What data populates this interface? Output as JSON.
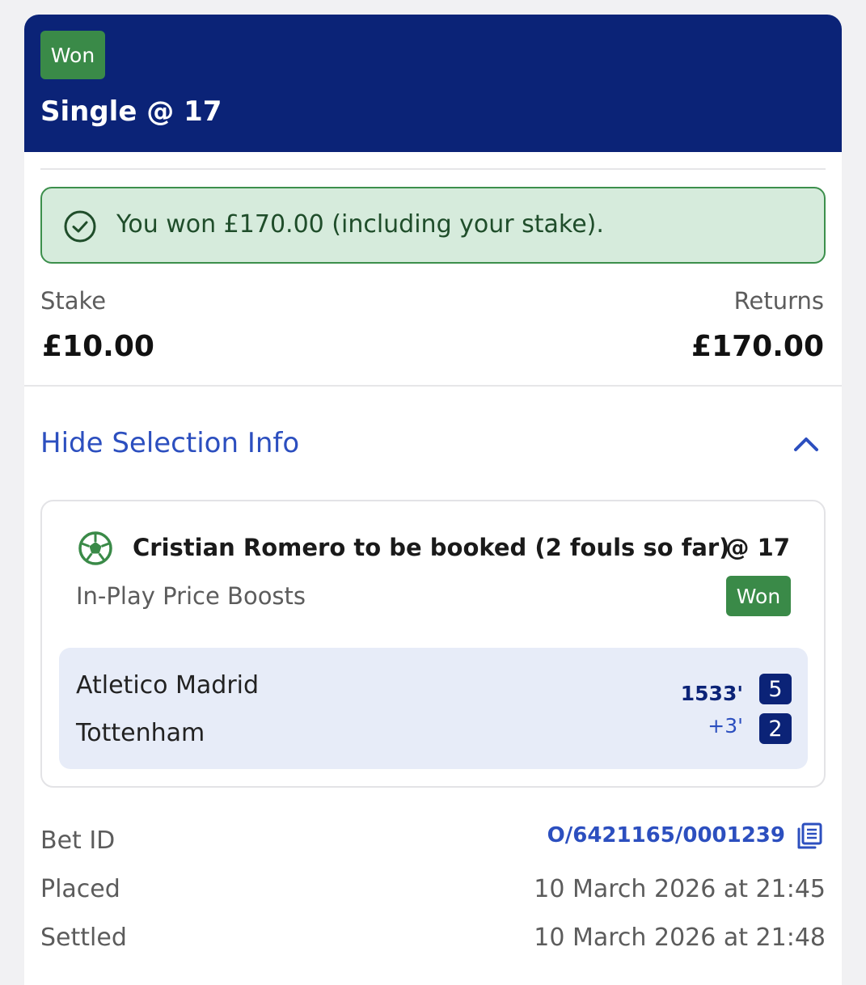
{
  "header": {
    "status_badge": "Won",
    "title": "Single @ 17",
    "background_color": "#0b2377"
  },
  "win_banner": {
    "icon": "check-circle-icon",
    "text": "You won £170.00 (including your stake)."
  },
  "summary": {
    "stake_label": "Stake",
    "stake_value": "£10.00",
    "returns_label": "Returns",
    "returns_value": "£170.00"
  },
  "selection_toggle": {
    "label": "Hide Selection Info",
    "icon": "chevron-up-icon"
  },
  "selection": {
    "sport_icon": "football-icon",
    "title": "Cristian Romero to be booked (2 fouls so far)",
    "odds": "@ 17",
    "market": "In-Play Price Boosts",
    "status_badge": "Won",
    "match": {
      "home_team": "Atletico Madrid",
      "away_team": "Tottenham",
      "clock": "1533'",
      "added_time": "+3'",
      "home_score": "5",
      "away_score": "2"
    }
  },
  "details": {
    "bet_id_label": "Bet ID",
    "bet_id_value": "O/6421165/0001239",
    "copy_icon": "copy-icon",
    "placed_label": "Placed",
    "placed_value": "10 March 2026 at 21:45",
    "settled_label": "Settled",
    "settled_value": "10 March 2026 at 21:48"
  },
  "colors": {
    "accent_blue": "#2c4fbf",
    "won_green": "#3a8a48",
    "banner_bg": "#d6ebdc"
  }
}
